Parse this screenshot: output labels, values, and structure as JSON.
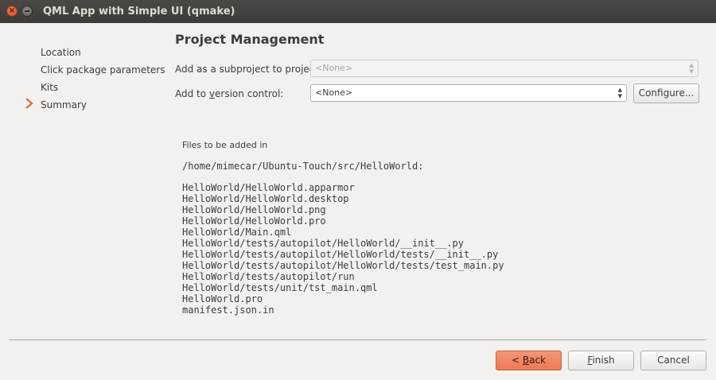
{
  "window": {
    "title": "QML App with Simple UI (qmake)",
    "close_symbol": "×"
  },
  "sidebar": {
    "items": [
      {
        "label": "Location"
      },
      {
        "label": "Click package parameters"
      },
      {
        "label": "Kits"
      },
      {
        "label": "Summary",
        "current": true
      }
    ]
  },
  "main": {
    "title": "Project Management",
    "subproject": {
      "label": "Add as a subproject to project:",
      "value": "<None>",
      "enabled": false
    },
    "version_control": {
      "label_before": "Add to ",
      "label_mnemonic": "v",
      "label_after": "ersion control:",
      "value": "<None>"
    },
    "configure_button": "Configure...",
    "files_caption": "Files to be added in",
    "directory": "/home/mimecar/Ubuntu-Touch/src/HelloWorld:",
    "files": [
      "HelloWorld/HelloWorld.apparmor",
      "HelloWorld/HelloWorld.desktop",
      "HelloWorld/HelloWorld.png",
      "HelloWorld/HelloWorld.pro",
      "HelloWorld/Main.qml",
      "HelloWorld/tests/autopilot/HelloWorld/__init__.py",
      "HelloWorld/tests/autopilot/HelloWorld/tests/__init__.py",
      "HelloWorld/tests/autopilot/HelloWorld/tests/test_main.py",
      "HelloWorld/tests/autopilot/run",
      "HelloWorld/tests/unit/tst_main.qml",
      "HelloWorld.pro",
      "manifest.json.in"
    ]
  },
  "footer": {
    "back_prefix": "< ",
    "back_mnemonic": "B",
    "back_rest": "ack",
    "finish_mnemonic": "F",
    "finish_rest": "inish",
    "cancel": "Cancel"
  },
  "colors": {
    "titlebar": "#3c3b37",
    "accent": "#ec7a56",
    "close_button": "#d74f26",
    "window_bg": "#f2f1f0"
  },
  "icons": {
    "current_page": "chevron-right-icon",
    "close": "close-icon",
    "minimize": "minimize-icon"
  }
}
